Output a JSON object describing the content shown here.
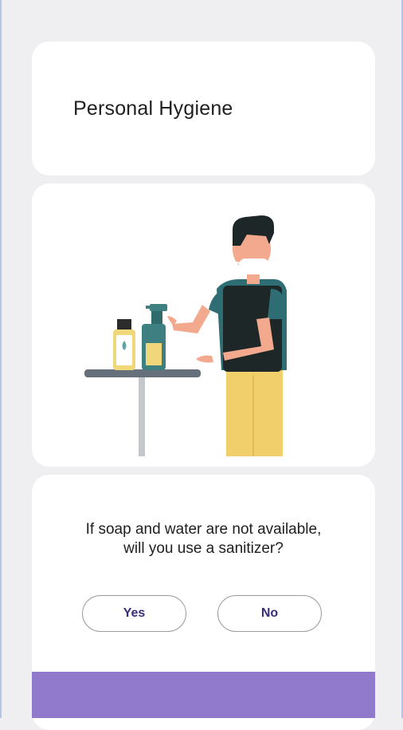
{
  "header": {
    "title": "Personal Hygiene"
  },
  "illustration": {
    "icon": "person-sanitizing-hands-illustration"
  },
  "question": {
    "line1": "If soap and water are not available,",
    "line2": "will you use a sanitizer?"
  },
  "answers": {
    "yes_label": "Yes",
    "no_label": "No"
  },
  "colors": {
    "accent": "#9179cb",
    "button_text": "#3b2d7a",
    "background": "#efeff1",
    "card": "#ffffff"
  }
}
